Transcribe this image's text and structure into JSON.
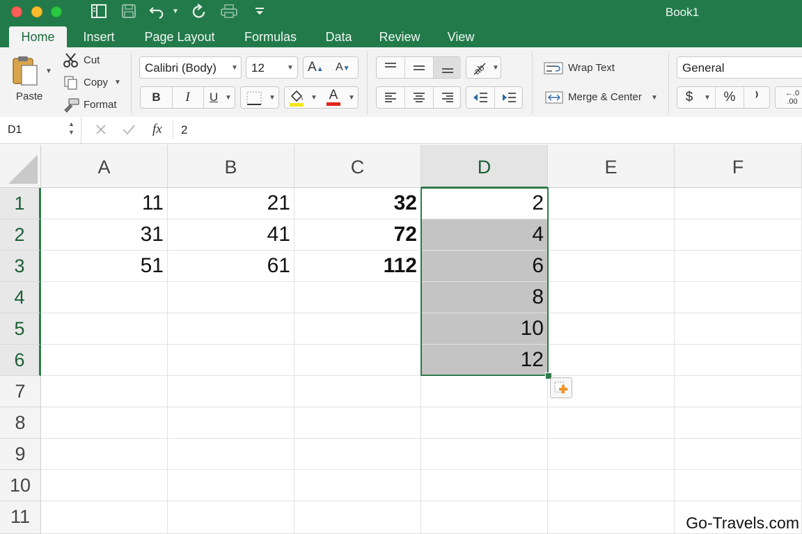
{
  "window": {
    "title": "Book1"
  },
  "tabs": [
    "Home",
    "Insert",
    "Page Layout",
    "Formulas",
    "Data",
    "Review",
    "View"
  ],
  "clipboard": {
    "paste": "Paste",
    "cut": "Cut",
    "copy": "Copy",
    "format": "Format"
  },
  "font": {
    "name": "Calibri (Body)",
    "size": "12",
    "bold": "B",
    "italic": "I",
    "underline": "U",
    "grow": "A",
    "shrink": "A",
    "font_color_letter": "A"
  },
  "alignment": {
    "wrap_text": "Wrap Text",
    "merge_center": "Merge & Center"
  },
  "number": {
    "format": "General",
    "currency": "$",
    "percent": "%",
    "comma": "⁾",
    "increase_decimal": "←.0\n.00"
  },
  "formula_bar": {
    "name_box": "D1",
    "fx": "fx",
    "value": "2"
  },
  "columns": [
    "A",
    "B",
    "C",
    "D",
    "E",
    "F"
  ],
  "rows": [
    "1",
    "2",
    "3",
    "4",
    "5",
    "6",
    "7",
    "8",
    "9",
    "10",
    "11"
  ],
  "cells": {
    "A": [
      "11",
      "31",
      "51"
    ],
    "B": [
      "21",
      "41",
      "61"
    ],
    "C": [
      "32",
      "72",
      "112"
    ],
    "D": [
      "2",
      "4",
      "6",
      "8",
      "10",
      "12"
    ]
  },
  "watermark": "Go-Travels.com",
  "colors": {
    "excel_green": "#227a4a",
    "selection_border": "#2e7a4a",
    "selection_fill": "#c4c4c4"
  }
}
